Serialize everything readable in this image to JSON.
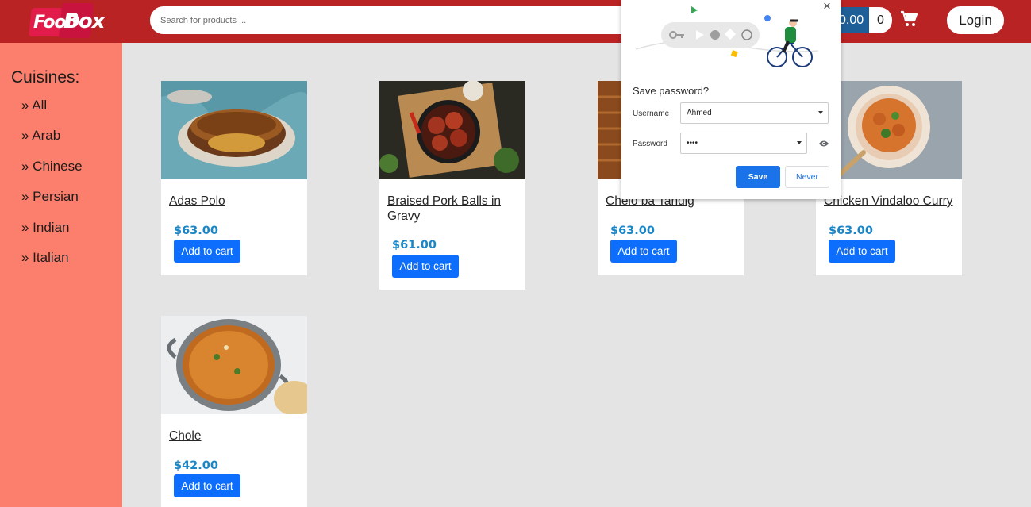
{
  "header": {
    "logo_text": [
      "FooD",
      "Box"
    ],
    "search_placeholder": "Search for products ...",
    "cart_amount": "0.00",
    "cart_count": "0",
    "login_label": "Login"
  },
  "sidebar": {
    "title": "Cuisines:",
    "items": [
      "» All",
      "» Arab",
      "» Chinese",
      "» Persian",
      "» Indian",
      "» Italian"
    ]
  },
  "products": [
    {
      "name": "Adas Polo",
      "price": "$63.00",
      "button": "Add to cart"
    },
    {
      "name": "Braised Pork Balls in Gravy",
      "price": "$61.00",
      "button": "Add to cart"
    },
    {
      "name": "Chelo ba Tahdig",
      "price": "$63.00",
      "button": "Add to cart"
    },
    {
      "name": "Chicken Vindaloo Curry",
      "price": "$63.00",
      "button": "Add to cart"
    },
    {
      "name": "Chole",
      "price": "$42.00",
      "button": "Add to cart"
    }
  ],
  "password_popup": {
    "title": "Save password?",
    "username_label": "Username",
    "username_value": "Ahmed",
    "password_label": "Password",
    "password_value": "••••",
    "save_label": "Save",
    "never_label": "Never",
    "close_glyph": "×"
  },
  "colors": {
    "header": "#b92323",
    "sidebar": "#fc7f6d",
    "price": "#1b86c6",
    "button": "#0d6efd",
    "popup_accent": "#1a73e8"
  }
}
